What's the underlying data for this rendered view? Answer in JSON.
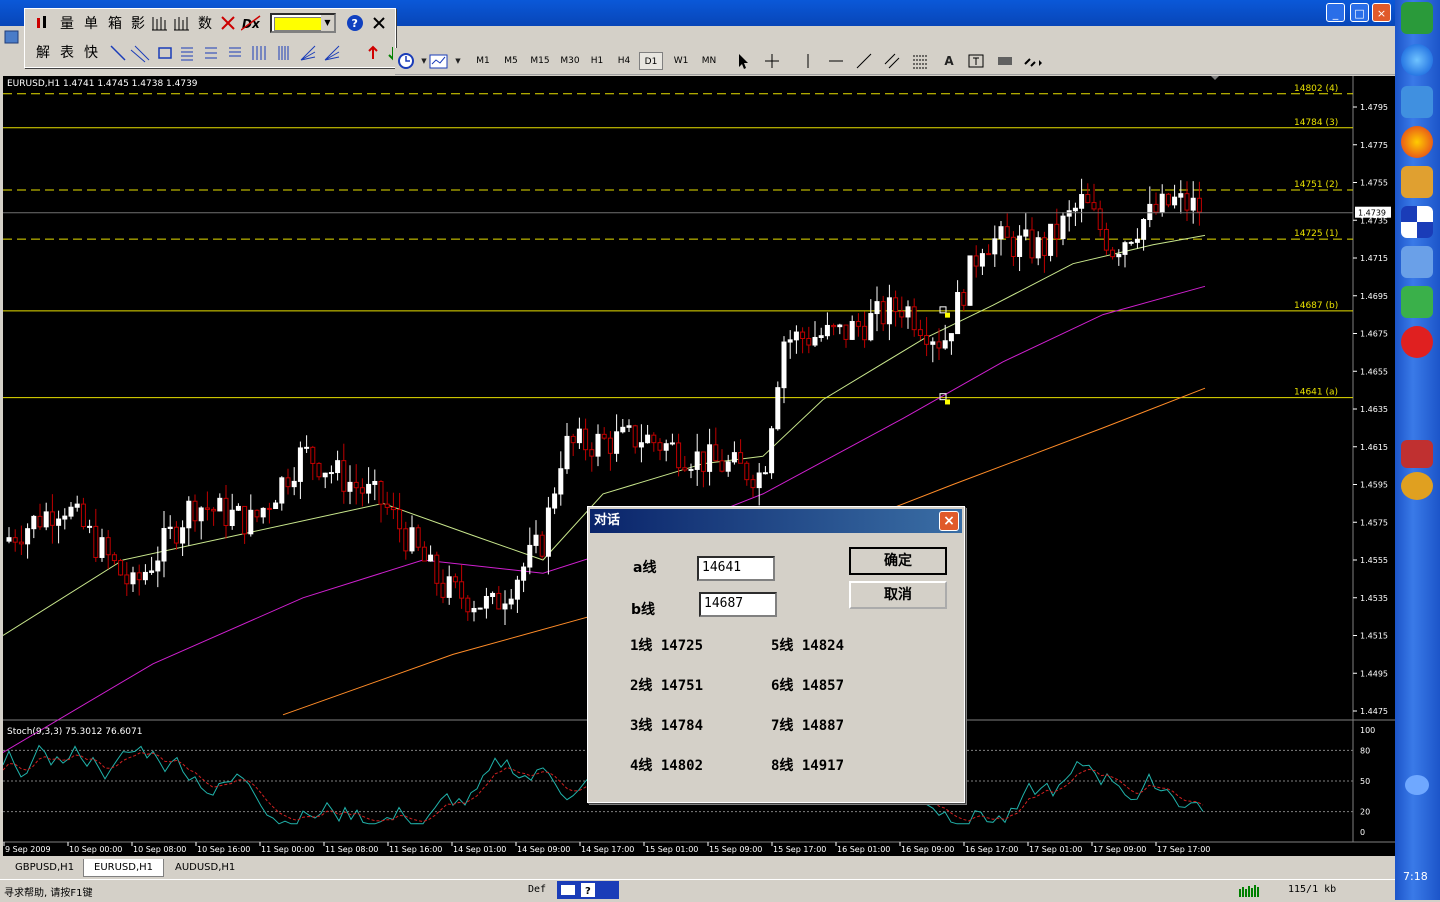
{
  "window": {
    "minimize": "_",
    "maximize": "□",
    "close": "×"
  },
  "floatbar": {
    "row1": [
      "量",
      "单",
      "箱",
      "影",
      "数"
    ],
    "row2": [
      "解",
      "表",
      "快"
    ]
  },
  "timeframes": [
    "M1",
    "M5",
    "M15",
    "M30",
    "H1",
    "H4",
    "D1",
    "W1",
    "MN"
  ],
  "active_timeframe": "D1",
  "chart": {
    "header": "EURUSD,H1  1.4741 1.4745 1.4738 1.4739",
    "indicator_header": "Stoch(9,3,3) 75.3012 76.6071",
    "current_price": "1.4739",
    "price_ticks": [
      "1.4795",
      "1.4775",
      "1.4755",
      "1.4735",
      "1.4715",
      "1.4695",
      "1.4675",
      "1.4655",
      "1.4635",
      "1.4615",
      "1.4595",
      "1.4575",
      "1.4555",
      "1.4535",
      "1.4515",
      "1.4495",
      "1.4475"
    ],
    "stoch_ticks": [
      "100",
      "80",
      "50",
      "20",
      "0"
    ],
    "time_ticks": [
      "9 Sep 2009",
      "10 Sep 00:00",
      "10 Sep 08:00",
      "10 Sep 16:00",
      "11 Sep 00:00",
      "11 Sep 08:00",
      "11 Sep 16:00",
      "14 Sep 01:00",
      "14 Sep 09:00",
      "14 Sep 17:00",
      "15 Sep 01:00",
      "15 Sep 09:00",
      "15 Sep 17:00",
      "16 Sep 01:00",
      "16 Sep 09:00",
      "16 Sep 17:00",
      "17 Sep 01:00",
      "17 Sep 09:00",
      "17 Sep 17:00"
    ],
    "levels": [
      {
        "label": "14802 (4)",
        "price": 1.4802,
        "style": "dash"
      },
      {
        "label": "14784 (3)",
        "price": 1.4784,
        "style": "solid"
      },
      {
        "label": "14751 (2)",
        "price": 1.4751,
        "style": "dash"
      },
      {
        "label": "14725 (1)",
        "price": 1.4725,
        "style": "dash"
      },
      {
        "label": "14687 (b)",
        "price": 1.4687,
        "style": "solid"
      },
      {
        "label": "14641 (a)",
        "price": 1.4641,
        "style": "solid"
      }
    ],
    "colors": {
      "bull": "#ffffff",
      "bear": "#c00000",
      "ma_fast": "#c8e68c",
      "ma_mid": "#d020d0",
      "ma_slow": "#ff8c28",
      "level": "#e8e000"
    }
  },
  "tabs": [
    "GBPUSD,H1",
    "EURUSD,H1",
    "AUDUSD,H1"
  ],
  "active_tab": "EURUSD,H1",
  "status": {
    "help": "寻求帮助, 请按F1键",
    "profile": "Def",
    "traffic": "115/1 kb"
  },
  "dialog": {
    "title": "对话",
    "a_label": "a线",
    "a_value": "14641",
    "b_label": "b线",
    "b_value": "14687",
    "ok": "确定",
    "cancel": "取消",
    "lines_left": [
      "1线 14725",
      "2线 14751",
      "3线 14784",
      "4线 14802"
    ],
    "lines_right": [
      "5线 14824",
      "6线 14857",
      "7线 14887",
      "8线 14917"
    ]
  },
  "clock": "7:18"
}
